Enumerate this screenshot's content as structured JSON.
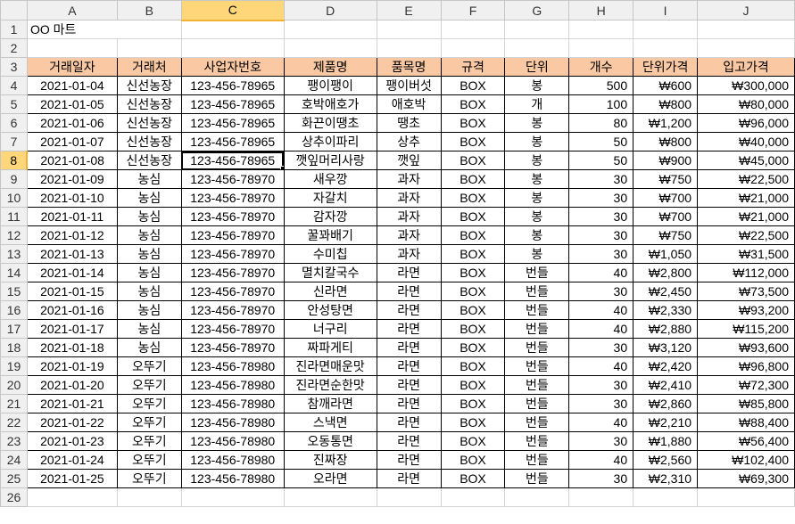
{
  "sheet": {
    "columns": [
      "A",
      "B",
      "C",
      "D",
      "E",
      "F",
      "G",
      "H",
      "I",
      "J"
    ],
    "row_numbers": [
      "1",
      "2",
      "3",
      "4",
      "5",
      "6",
      "7",
      "8",
      "9",
      "10",
      "11",
      "12",
      "13",
      "14",
      "15",
      "16",
      "17",
      "18",
      "19",
      "20",
      "21",
      "22",
      "23",
      "24",
      "25",
      "26"
    ],
    "title": "OO 마트",
    "headers": [
      "거래일자",
      "거래처",
      "사업자번호",
      "제품명",
      "품목명",
      "규격",
      "단위",
      "개수",
      "단위가격",
      "입고가격"
    ],
    "rows": [
      [
        "2021-01-04",
        "신선농장",
        "123-456-78965",
        "팽이팽이",
        "팽이버섯",
        "BOX",
        "봉",
        "500",
        "₩600",
        "₩300,000"
      ],
      [
        "2021-01-05",
        "신선농장",
        "123-456-78965",
        "호박애호가",
        "애호박",
        "BOX",
        "개",
        "100",
        "₩800",
        "₩80,000"
      ],
      [
        "2021-01-06",
        "신선농장",
        "123-456-78965",
        "화끈이땡초",
        "땡초",
        "BOX",
        "봉",
        "80",
        "₩1,200",
        "₩96,000"
      ],
      [
        "2021-01-07",
        "신선농장",
        "123-456-78965",
        "상추이파리",
        "상추",
        "BOX",
        "봉",
        "50",
        "₩800",
        "₩40,000"
      ],
      [
        "2021-01-08",
        "신선농장",
        "123-456-78965",
        "깻잎머리사랑",
        "깻잎",
        "BOX",
        "봉",
        "50",
        "₩900",
        "₩45,000"
      ],
      [
        "2021-01-09",
        "농심",
        "123-456-78970",
        "새우깡",
        "과자",
        "BOX",
        "봉",
        "30",
        "₩750",
        "₩22,500"
      ],
      [
        "2021-01-10",
        "농심",
        "123-456-78970",
        "자갈치",
        "과자",
        "BOX",
        "봉",
        "30",
        "₩700",
        "₩21,000"
      ],
      [
        "2021-01-11",
        "농심",
        "123-456-78970",
        "감자깡",
        "과자",
        "BOX",
        "봉",
        "30",
        "₩700",
        "₩21,000"
      ],
      [
        "2021-01-12",
        "농심",
        "123-456-78970",
        "꿀꽈배기",
        "과자",
        "BOX",
        "봉",
        "30",
        "₩750",
        "₩22,500"
      ],
      [
        "2021-01-13",
        "농심",
        "123-456-78970",
        "수미칩",
        "과자",
        "BOX",
        "봉",
        "30",
        "₩1,050",
        "₩31,500"
      ],
      [
        "2021-01-14",
        "농심",
        "123-456-78970",
        "멸치칼국수",
        "라면",
        "BOX",
        "번들",
        "40",
        "₩2,800",
        "₩112,000"
      ],
      [
        "2021-01-15",
        "농심",
        "123-456-78970",
        "신라면",
        "라면",
        "BOX",
        "번들",
        "30",
        "₩2,450",
        "₩73,500"
      ],
      [
        "2021-01-16",
        "농심",
        "123-456-78970",
        "안성탕면",
        "라면",
        "BOX",
        "번들",
        "40",
        "₩2,330",
        "₩93,200"
      ],
      [
        "2021-01-17",
        "농심",
        "123-456-78970",
        "너구리",
        "라면",
        "BOX",
        "번들",
        "40",
        "₩2,880",
        "₩115,200"
      ],
      [
        "2021-01-18",
        "농심",
        "123-456-78970",
        "짜파게티",
        "라면",
        "BOX",
        "번들",
        "30",
        "₩3,120",
        "₩93,600"
      ],
      [
        "2021-01-19",
        "오뚜기",
        "123-456-78980",
        "진라면매운맛",
        "라면",
        "BOX",
        "번들",
        "40",
        "₩2,420",
        "₩96,800"
      ],
      [
        "2021-01-20",
        "오뚜기",
        "123-456-78980",
        "진라면순한맛",
        "라면",
        "BOX",
        "번들",
        "30",
        "₩2,410",
        "₩72,300"
      ],
      [
        "2021-01-21",
        "오뚜기",
        "123-456-78980",
        "참깨라면",
        "라면",
        "BOX",
        "번들",
        "30",
        "₩2,860",
        "₩85,800"
      ],
      [
        "2021-01-22",
        "오뚜기",
        "123-456-78980",
        "스낵면",
        "라면",
        "BOX",
        "번들",
        "40",
        "₩2,210",
        "₩88,400"
      ],
      [
        "2021-01-23",
        "오뚜기",
        "123-456-78980",
        "오동통면",
        "라면",
        "BOX",
        "번들",
        "30",
        "₩1,880",
        "₩56,400"
      ],
      [
        "2021-01-24",
        "오뚜기",
        "123-456-78980",
        "진짜장",
        "라면",
        "BOX",
        "번들",
        "40",
        "₩2,560",
        "₩102,400"
      ],
      [
        "2021-01-25",
        "오뚜기",
        "123-456-78980",
        "오라면",
        "라면",
        "BOX",
        "번들",
        "30",
        "₩2,310",
        "₩69,300"
      ]
    ],
    "selected_cell": "C8"
  }
}
